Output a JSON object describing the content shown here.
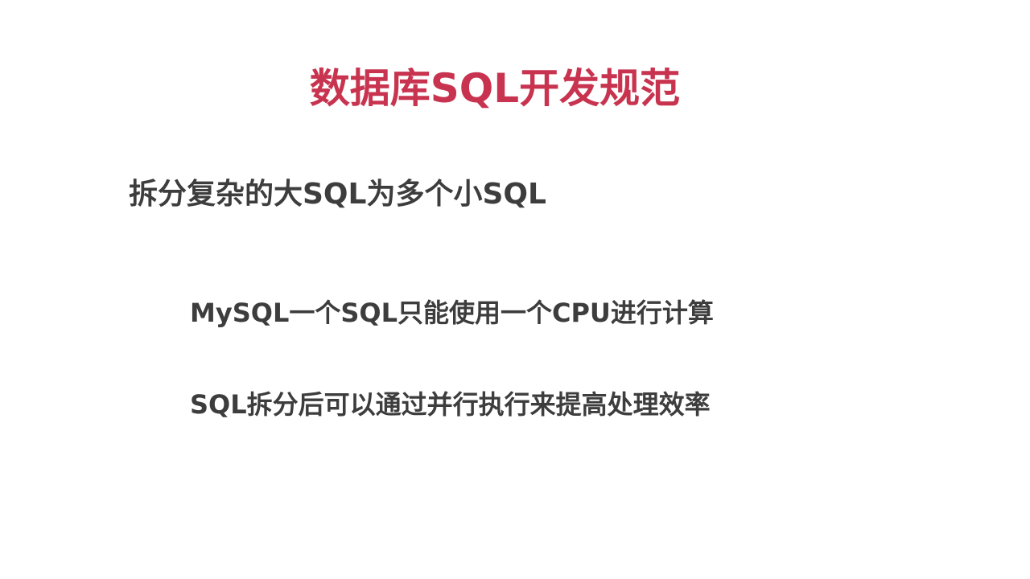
{
  "slide": {
    "title": "数据库SQL开发规范",
    "subtitle": "拆分复杂的大SQL为多个小SQL",
    "points": [
      "MySQL一个SQL只能使用一个CPU进行计算",
      "SQL拆分后可以通过并行执行来提高处理效率"
    ],
    "colors": {
      "title": "#c8344f",
      "text": "#3d3d3d",
      "background": "#ffffff"
    }
  }
}
